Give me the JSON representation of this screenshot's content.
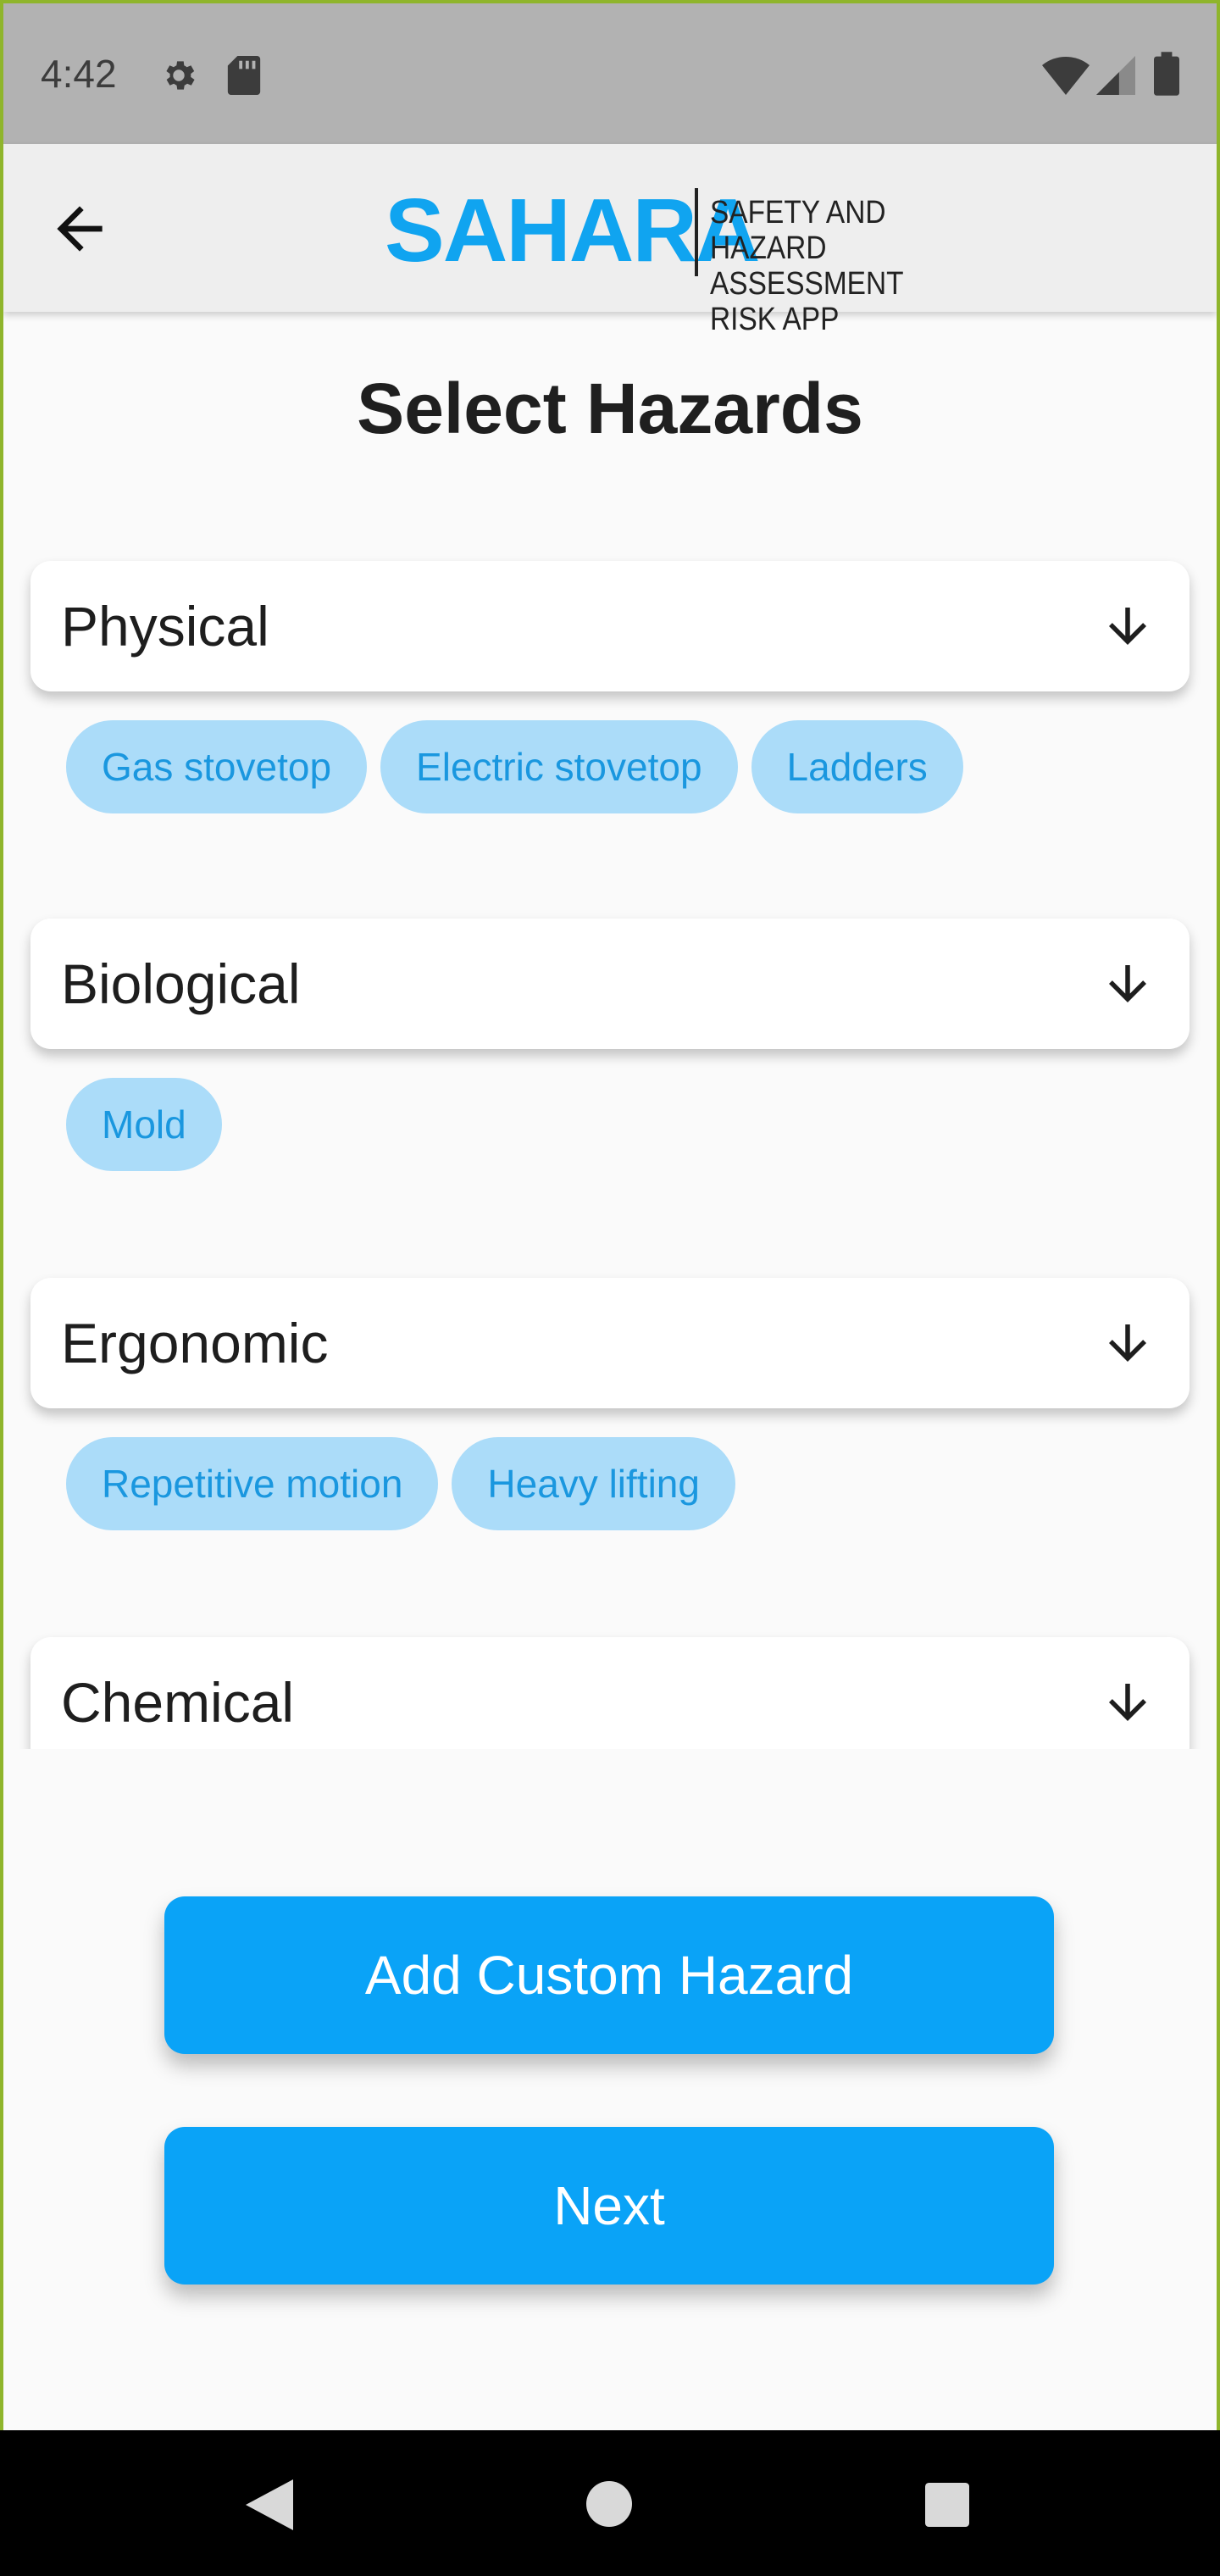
{
  "status_bar": {
    "time": "4:42",
    "icons": [
      "gear-icon",
      "sd-card-icon",
      "wifi-icon",
      "signal-icon",
      "battery-icon"
    ]
  },
  "app_bar": {
    "back_icon": "arrow-left-icon",
    "logo_text": "SAHARA",
    "logo_tagline_line1": "SAFETY AND HAZARD",
    "logo_tagline_line2": "ASSESSMENT RISK APP"
  },
  "page_title": "Select Hazards",
  "categories": [
    {
      "label": "Physical",
      "icon": "arrow-down-icon",
      "chips": [
        "Gas stovetop",
        "Electric stovetop",
        "Ladders"
      ]
    },
    {
      "label": "Biological",
      "icon": "arrow-down-icon",
      "chips": [
        "Mold"
      ]
    },
    {
      "label": "Ergonomic",
      "icon": "arrow-down-icon",
      "chips": [
        "Repetitive motion",
        "Heavy lifting"
      ]
    },
    {
      "label": "Chemical",
      "icon": "arrow-down-icon",
      "chips": []
    }
  ],
  "buttons": {
    "add_custom": "Add Custom Hazard",
    "next": "Next"
  },
  "colors": {
    "accent": "#0aa3f7",
    "chip_bg": "#abdcf9",
    "chip_text": "#1a97df",
    "status_bar": "#b2b2b2",
    "app_bar": "#eeeeee"
  },
  "nav_bar": {
    "icons": [
      "nav-back-icon",
      "nav-home-icon",
      "nav-recents-icon"
    ]
  }
}
